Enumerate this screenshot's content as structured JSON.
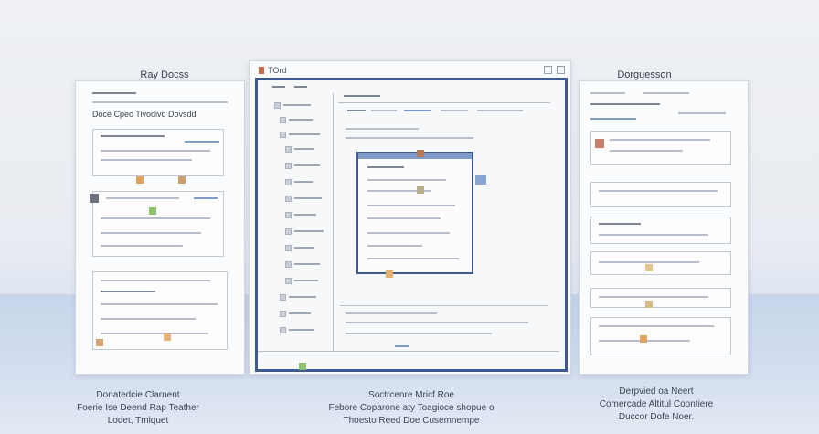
{
  "panels": {
    "left": {
      "label": "Ray Docss",
      "heading": "Doce Cpeo Tivodivo Dovsdd"
    },
    "center": {
      "window_title": "TOrd"
    },
    "right": {
      "label": "Dorguesson"
    }
  },
  "captions": {
    "left": [
      "Donatedcie Clarnent",
      "Foerie Ise Deend Rap Teather",
      "Lodet, Tmiquet"
    ],
    "center": [
      "Soctrcenre Mricf Roe",
      "Febore Coparone aty Toagioce shopue o",
      "Thoesto Reed Doe Cusemnempe"
    ],
    "right": [
      "Derpvied oa Neert",
      "Comercade Altitul Coontiere",
      "Duccor Dofe Noer."
    ]
  },
  "colors": {
    "accent": "#3c5a8f",
    "chip_orange": "#e0a25c",
    "chip_green": "#8cc06a",
    "chip_brown": "#b5795a"
  }
}
